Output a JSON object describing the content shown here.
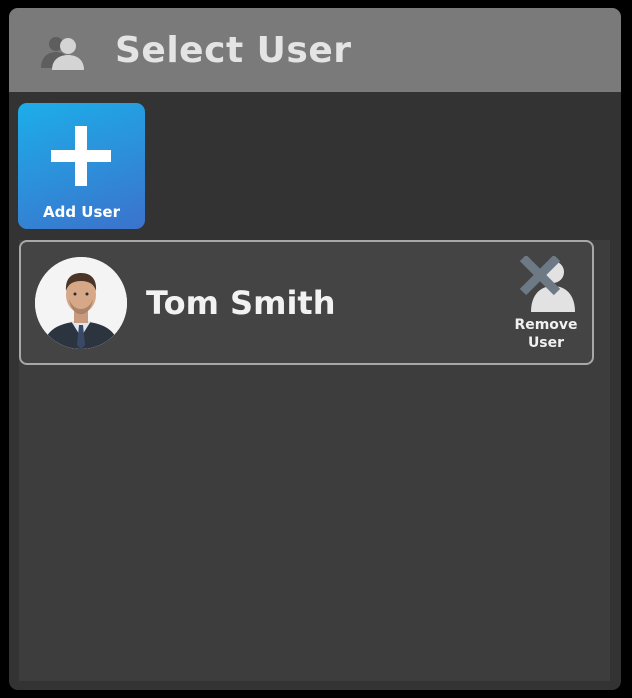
{
  "header": {
    "title": "Select User",
    "icon": "users-icon"
  },
  "add_user": {
    "label": "Add User",
    "icon": "plus-icon",
    "gradient_colors": [
      "#1daee9",
      "#3b72cc"
    ]
  },
  "users": [
    {
      "name": "Tom Smith",
      "avatar": "profile-photo",
      "remove_label_line1": "Remove",
      "remove_label_line2": "User",
      "remove_icon": "remove-user-icon"
    }
  ],
  "colors": {
    "header_bg": "#7a7a7a",
    "window_bg": "#333333",
    "card_border": "#a8a8a8",
    "text": "#f2f2f2"
  }
}
